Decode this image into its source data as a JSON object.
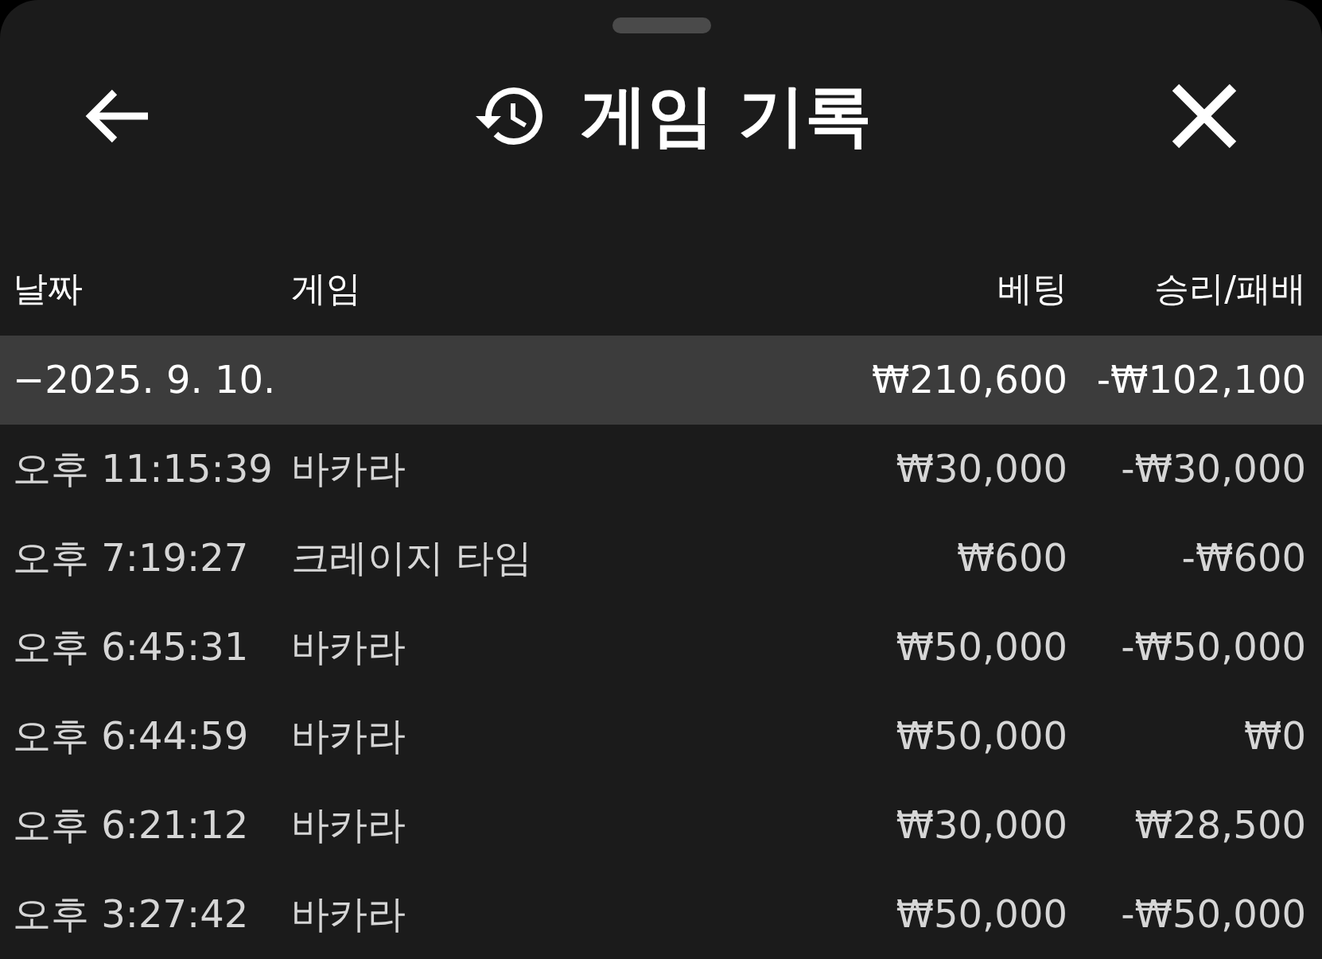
{
  "title": "게임 기록",
  "columns": [
    "날짜",
    "게임",
    "베팅",
    "승리/패배"
  ],
  "group": {
    "date": "−2025. 9. 10.",
    "bet": "₩210,600",
    "result": "-₩102,100",
    "expanded": true
  },
  "rows": [
    {
      "time": "오후 11:15:39",
      "game": "바카라",
      "bet": "₩30,000",
      "result": "-₩30,000"
    },
    {
      "time": "오후 7:19:27",
      "game": "크레이지 타임",
      "bet": "₩600",
      "result": "-₩600"
    },
    {
      "time": "오후 6:45:31",
      "game": "바카라",
      "bet": "₩50,000",
      "result": "-₩50,000"
    },
    {
      "time": "오후 6:44:59",
      "game": "바카라",
      "bet": "₩50,000",
      "result": "₩0"
    },
    {
      "time": "오후 6:21:12",
      "game": "바카라",
      "bet": "₩30,000",
      "result": "₩28,500"
    },
    {
      "time": "오후 3:27:42",
      "game": "바카라",
      "bet": "₩50,000",
      "result": "-₩50,000"
    }
  ]
}
